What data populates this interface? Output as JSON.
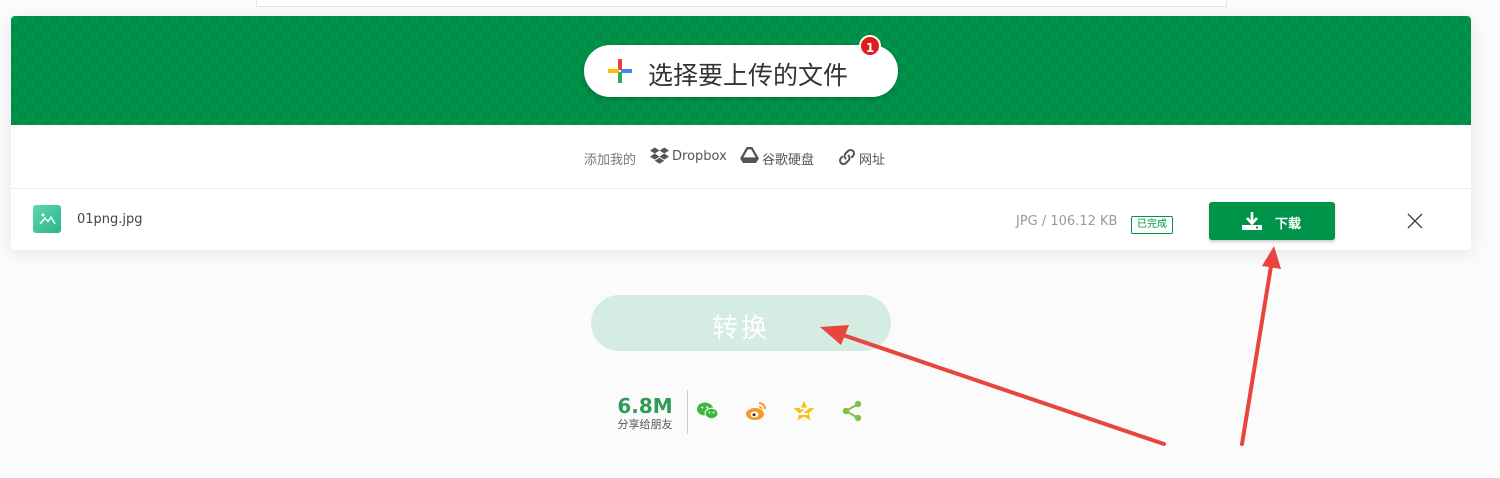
{
  "uploader": {
    "upload_label": "选择要上传的文件",
    "badge_count": "1",
    "accent_color": "#00944a",
    "plus_icon_colors": [
      "#ea4335",
      "#fbbc05",
      "#34a853",
      "#4285f4"
    ]
  },
  "sources": {
    "prefix": "添加我的",
    "items": [
      {
        "label": "Dropbox",
        "icon": "dropbox-icon"
      },
      {
        "label": "谷歌硬盘",
        "icon": "google-drive-icon"
      },
      {
        "label": "网址",
        "icon": "link-icon"
      }
    ]
  },
  "file": {
    "name": "01png.jpg",
    "meta": "JPG / 106.12 KB",
    "status": "已完成",
    "download_label": "下载",
    "thumb_icon": "image-icon",
    "close_icon": "close-icon"
  },
  "convert": {
    "label": "转换"
  },
  "share": {
    "count": "6.8M",
    "label": "分享给朋友",
    "icons": [
      "wechat-icon",
      "weibo-icon",
      "qzone-icon",
      "share-icon"
    ]
  },
  "annotations": {
    "arrow_color": "#e8453c"
  }
}
